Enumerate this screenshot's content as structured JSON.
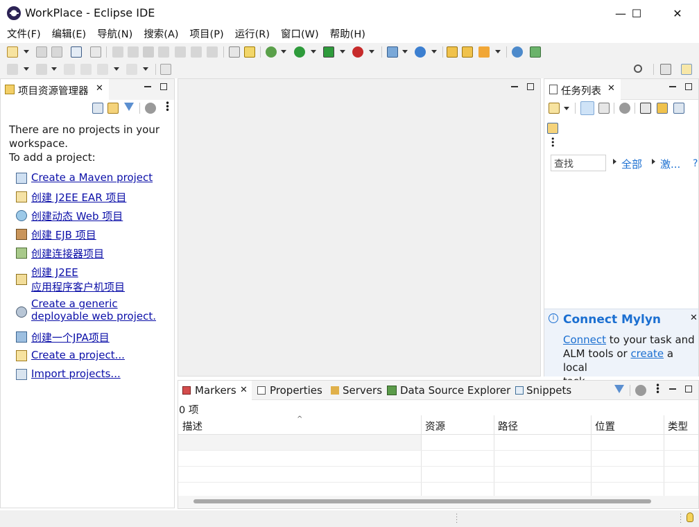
{
  "window": {
    "title": "WorkPlace - Eclipse IDE",
    "minimize_glyph": "—",
    "maximize_glyph": "☐",
    "close_glyph": "✕"
  },
  "menubar": {
    "items": [
      "文件(F)",
      "编辑(E)",
      "导航(N)",
      "搜索(A)",
      "项目(P)",
      "运行(R)",
      "窗口(W)",
      "帮助(H)"
    ]
  },
  "project_explorer": {
    "tab_label": "项目资源管理器",
    "empty_line1": "There are no projects in your",
    "empty_line2": "workspace.",
    "add_line": "To add a project:",
    "links": [
      {
        "text": "Create a Maven project",
        "icon": "maven-project-icon"
      },
      {
        "text": "创建 J2EE EAR 项目",
        "icon": "ear-project-icon"
      },
      {
        "text": "创建动态 Web 项目",
        "icon": "web-project-icon"
      },
      {
        "text": "创建 EJB 项目",
        "icon": "ejb-project-icon"
      },
      {
        "text": "创建连接器项目",
        "icon": "connector-project-icon"
      },
      {
        "text": "创建 J2EE",
        "text2": "应用程序客户机项目",
        "icon": "app-client-project-icon"
      },
      {
        "text": "Create a generic",
        "text2": "deployable web project.",
        "icon": "generic-web-project-icon"
      },
      {
        "text": "创建一个JPA项目",
        "icon": "jpa-project-icon"
      },
      {
        "text": "Create a project...",
        "icon": "new-project-icon"
      },
      {
        "text": "Import projects...",
        "icon": "import-icon"
      }
    ]
  },
  "task_list": {
    "tab_label": "任务列表",
    "find_placeholder": "查找",
    "all_label": "全部",
    "activate_label": "激...",
    "help_glyph": "?"
  },
  "mylyn": {
    "title": "Connect Mylyn",
    "connect_link": "Connect",
    "text1": " to your task and",
    "text2": "ALM tools or ",
    "create_link": "create",
    "text3": " a local",
    "text4": "task."
  },
  "bottom": {
    "tabs": [
      "Markers",
      "Properties",
      "Servers",
      "Data Source Explorer",
      "Snippets"
    ],
    "count": "0 项",
    "columns": [
      "描述",
      "资源",
      "路径",
      "位置",
      "类型"
    ]
  },
  "colors": {
    "accent": "#0b0fa8",
    "mylyn_title": "#1b6fd1",
    "toolbar_bg": "#f2f2f2"
  }
}
